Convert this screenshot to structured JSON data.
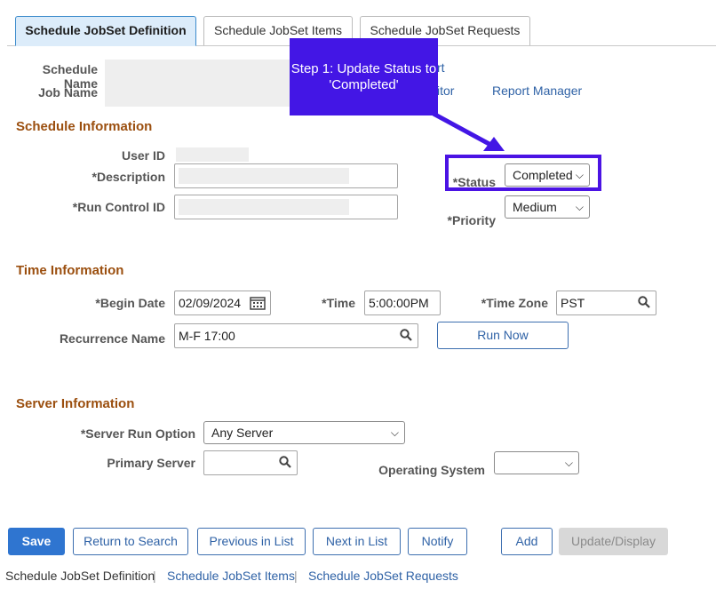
{
  "tabs": [
    {
      "label": "Schedule JobSet Definition",
      "active": true
    },
    {
      "label": "Schedule JobSet Items",
      "active": false
    },
    {
      "label": "Schedule JobSet Requests",
      "active": false
    }
  ],
  "header": {
    "schedule_name_label": "Schedule Name",
    "job_name_label": "Job Name",
    "link_partial_1": "rt",
    "link_partial_2": "itor",
    "report_manager": "Report Manager"
  },
  "callout": {
    "text": "Step 1: Update Status to 'Completed'"
  },
  "schedule_info": {
    "title": "Schedule Information",
    "user_id_label": "User ID",
    "description_label": "*Description",
    "run_control_label": "*Run Control ID",
    "status_label": "*Status",
    "status_value": "Completed",
    "priority_label": "*Priority",
    "priority_value": "Medium"
  },
  "time_info": {
    "title": "Time Information",
    "begin_date_label": "*Begin Date",
    "begin_date_value": "02/09/2024",
    "time_label": "*Time",
    "time_value": "5:00:00PM",
    "time_zone_label": "*Time Zone",
    "time_zone_value": "PST",
    "recurrence_label": "Recurrence Name",
    "recurrence_value": "M-F 17:00",
    "run_now": "Run Now"
  },
  "server_info": {
    "title": "Server Information",
    "run_option_label": "*Server Run Option",
    "run_option_value": "Any Server",
    "primary_server_label": "Primary Server",
    "os_label": "Operating System"
  },
  "buttons": {
    "save": "Save",
    "return_to_search": "Return to Search",
    "previous_in_list": "Previous in List",
    "next_in_list": "Next in List",
    "notify": "Notify",
    "add": "Add",
    "update_display": "Update/Display"
  },
  "footer": {
    "current": "Schedule JobSet Definition",
    "link_items": "Schedule JobSet Items",
    "link_requests": "Schedule JobSet Requests"
  },
  "colors": {
    "accent": "#2f75d0",
    "callout": "#4316e5",
    "section_title": "#9b4f0f"
  }
}
